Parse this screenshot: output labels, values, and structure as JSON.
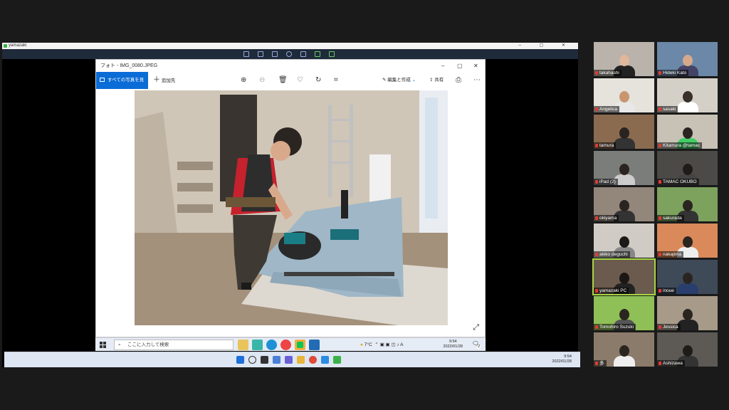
{
  "share": {
    "window_title": "yamazaki",
    "controls": "–  ▢  ✕"
  },
  "photos": {
    "title": "フォト - IMG_0080.JPEG",
    "all_photos": "すべての写真を見る",
    "add_to": "追加先",
    "edit_create": "編集と作成",
    "share": "共有"
  },
  "inner_taskbar": {
    "search_placeholder": "ここに入力して検索",
    "weather": "7°C",
    "ime": "A",
    "time": "9:54",
    "date": "2022/01/28",
    "notif": "2"
  },
  "outer_taskbar": {
    "time": "9:54",
    "date": "2022/01/28"
  },
  "participants": [
    {
      "name": "takahashi"
    },
    {
      "name": "Hideki Kato"
    },
    {
      "name": "Angelica"
    },
    {
      "name": "sasaki"
    },
    {
      "name": "tamura"
    },
    {
      "name": "Kitamura @tamac"
    },
    {
      "name": "iPad (2)"
    },
    {
      "name": "TAMAC OKUBO"
    },
    {
      "name": "okiyama"
    },
    {
      "name": "sakurada"
    },
    {
      "name": "akiko deguchi"
    },
    {
      "name": "nakajima"
    },
    {
      "name": "yamazaki PC"
    },
    {
      "name": "inoue"
    },
    {
      "name": "Tomohiro Suzuki"
    },
    {
      "name": "Jessica"
    },
    {
      "name": "多"
    },
    {
      "name": "Ashizawa"
    }
  ]
}
